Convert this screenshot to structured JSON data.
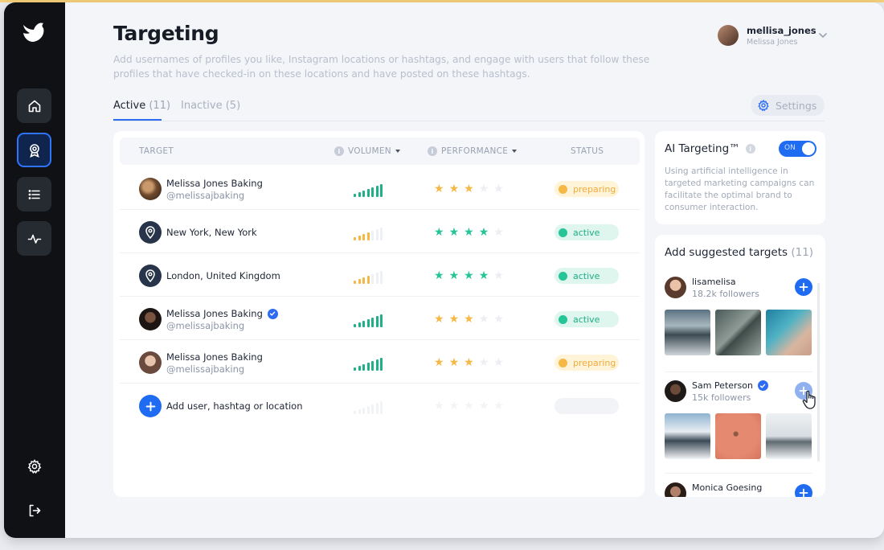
{
  "header": {
    "title": "Targeting",
    "subtitle": "Add usernames of profiles you like, Instagram locations or hashtags, and engage with users that follow these profiles that have checked-in on these locations and have posted on these hashtags."
  },
  "user": {
    "username": "mellisa_jones",
    "name": "Melissa Jones"
  },
  "tabs": [
    {
      "label": "Active",
      "count": "(11)"
    },
    {
      "label": "Inactive (5)"
    }
  ],
  "settings_label": "Settings",
  "table": {
    "headers": {
      "target": "TARGET",
      "volumen": "VOLUMEN",
      "performance": "PERFORMANCE",
      "status": "STATUS"
    },
    "rows": [
      {
        "name": "Melissa Jones Baking",
        "handle": "@melissajbaking",
        "type": "profile",
        "verified": false,
        "volume": 7,
        "volume_color": "green",
        "stars": 3,
        "star_color": "gold",
        "status": "preparing"
      },
      {
        "name": "New York, New York",
        "handle": "",
        "type": "location",
        "verified": false,
        "volume": 4,
        "volume_color": "orange",
        "stars": 4,
        "star_color": "green",
        "status": "active"
      },
      {
        "name": "London, United Kingdom",
        "handle": "",
        "type": "location",
        "verified": false,
        "volume": 4,
        "volume_color": "orange",
        "stars": 4,
        "star_color": "green",
        "status": "active"
      },
      {
        "name": "Melissa Jones Baking",
        "handle": "@melissajbaking",
        "type": "profile",
        "verified": true,
        "volume": 7,
        "volume_color": "green",
        "stars": 3,
        "star_color": "gold",
        "status": "active"
      },
      {
        "name": "Melissa Jones Baking",
        "handle": "@melissajbaking",
        "type": "profile",
        "verified": false,
        "volume": 7,
        "volume_color": "green",
        "stars": 3,
        "star_color": "gold",
        "status": "preparing"
      }
    ],
    "add_label": "Add user, hashtag or location"
  },
  "ai": {
    "title": "AI Targeting™",
    "toggle_label": "ON",
    "toggle_on": true,
    "description": "Using artificial intelligence in targeted marketing campaigns can facilitate the optimal brand to consumer interaction."
  },
  "suggested": {
    "title": "Add suggested targets",
    "count": "(11)",
    "items": [
      {
        "name": "lisamelisa",
        "followers": "18.2k followers",
        "verified": false
      },
      {
        "name": "Sam Peterson",
        "followers": "15k followers",
        "verified": true
      },
      {
        "name": "Monica Goesing",
        "followers": "",
        "verified": false
      }
    ]
  },
  "colors": {
    "accent": "#1f6cf3",
    "active_green": "#25c597",
    "preparing_orange": "#f6b845",
    "sidebar": "#0f1115"
  },
  "icons": [
    "bird-logo-icon",
    "home-icon",
    "targeting-badge-icon",
    "list-icon",
    "activity-icon",
    "gear-icon",
    "logout-icon",
    "location-pin-icon",
    "plus-icon",
    "verified-icon",
    "chevron-down-icon",
    "info-icon",
    "hand-cursor-icon"
  ]
}
